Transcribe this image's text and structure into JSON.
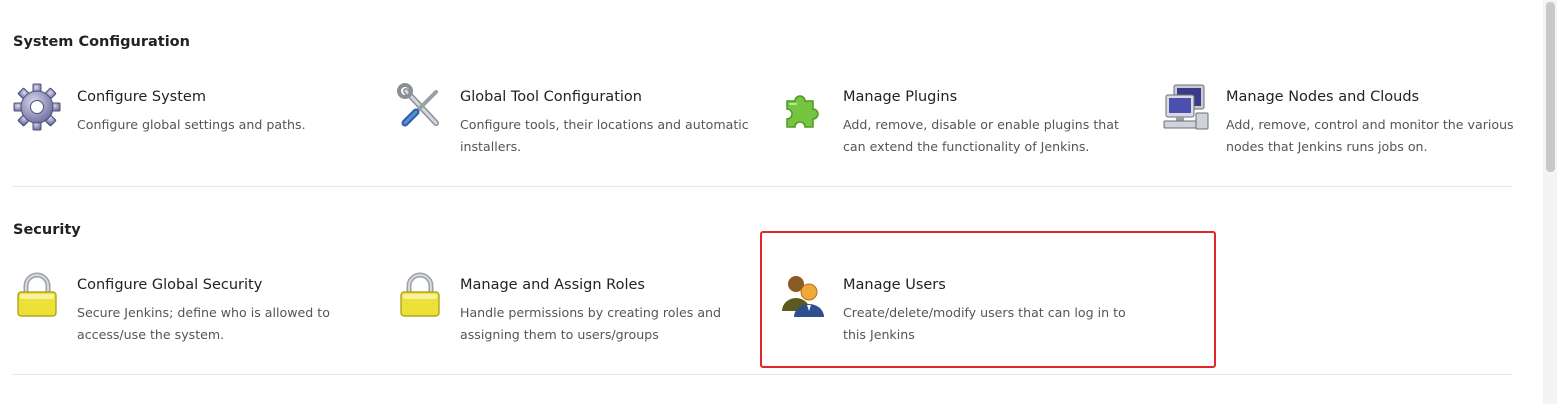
{
  "sections": [
    {
      "title": "System Configuration",
      "items": [
        {
          "title": "Configure System",
          "description": "Configure global settings and paths.",
          "icon": "gear-icon"
        },
        {
          "title": "Global Tool Configuration",
          "description": "Configure tools, their locations and automatic installers.",
          "icon": "tools-icon"
        },
        {
          "title": "Manage Plugins",
          "description": "Add, remove, disable or enable plugins that can extend the functionality of Jenkins.",
          "icon": "puzzle-icon"
        },
        {
          "title": "Manage Nodes and Clouds",
          "description": "Add, remove, control and monitor the various nodes that Jenkins runs jobs on.",
          "icon": "computer-icon"
        }
      ]
    },
    {
      "title": "Security",
      "items": [
        {
          "title": "Configure Global Security",
          "description": "Secure Jenkins; define who is allowed to access/use the system.",
          "icon": "lock-icon"
        },
        {
          "title": "Manage and Assign Roles",
          "description": "Handle permissions by creating roles and assigning them to users/groups",
          "icon": "lock-icon"
        },
        {
          "title": "Manage Users",
          "description": "Create/delete/modify users that can log in to this Jenkins",
          "icon": "users-icon"
        }
      ]
    }
  ],
  "colors": {
    "highlight_border": "#e0262a",
    "text_title": "#222222",
    "text_desc": "#555555",
    "divider": "#e9e9e9"
  }
}
